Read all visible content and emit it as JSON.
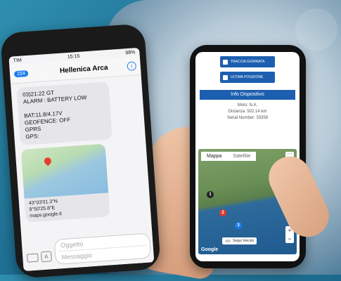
{
  "left_phone": {
    "status": {
      "carrier": "TIM",
      "time": "15:15",
      "battery": "98%"
    },
    "header": {
      "back_count": "154",
      "title": "Hellenica Arca"
    },
    "message_lines": [
      "03)21:22 GT",
      "ALARM : BATTERY LOW",
      "",
      "BAT:11.8/4.17V",
      "GEOFENCE: OFF",
      "GPRS",
      "GPS:"
    ],
    "map_caption_lines": [
      "43°03'01.3\"N",
      "9°50'25.8\"E",
      "maps.google.it"
    ],
    "composer": {
      "subject_placeholder": "Oggetto",
      "message_placeholder": "Messaggio"
    }
  },
  "right_phone": {
    "buttons": [
      "TRACCIA GIORNATA",
      "ULTIMA POSIZIONE"
    ],
    "info_title": "Info Dispositivo",
    "info_lines": [
      "Moto: N.A.",
      "Distanza: 502.14 km",
      "Serial Number: 33358"
    ],
    "map": {
      "tabs": [
        "Mappa",
        "Satellite"
      ],
      "markers": [
        "1",
        "2",
        "3"
      ],
      "follow_label": "Segui Veicolo",
      "logo": "Google"
    }
  },
  "colors": {
    "accent": "#1c5fb0",
    "imessage_blue": "#1e7cf0",
    "marker_red": "#e03a2e"
  }
}
